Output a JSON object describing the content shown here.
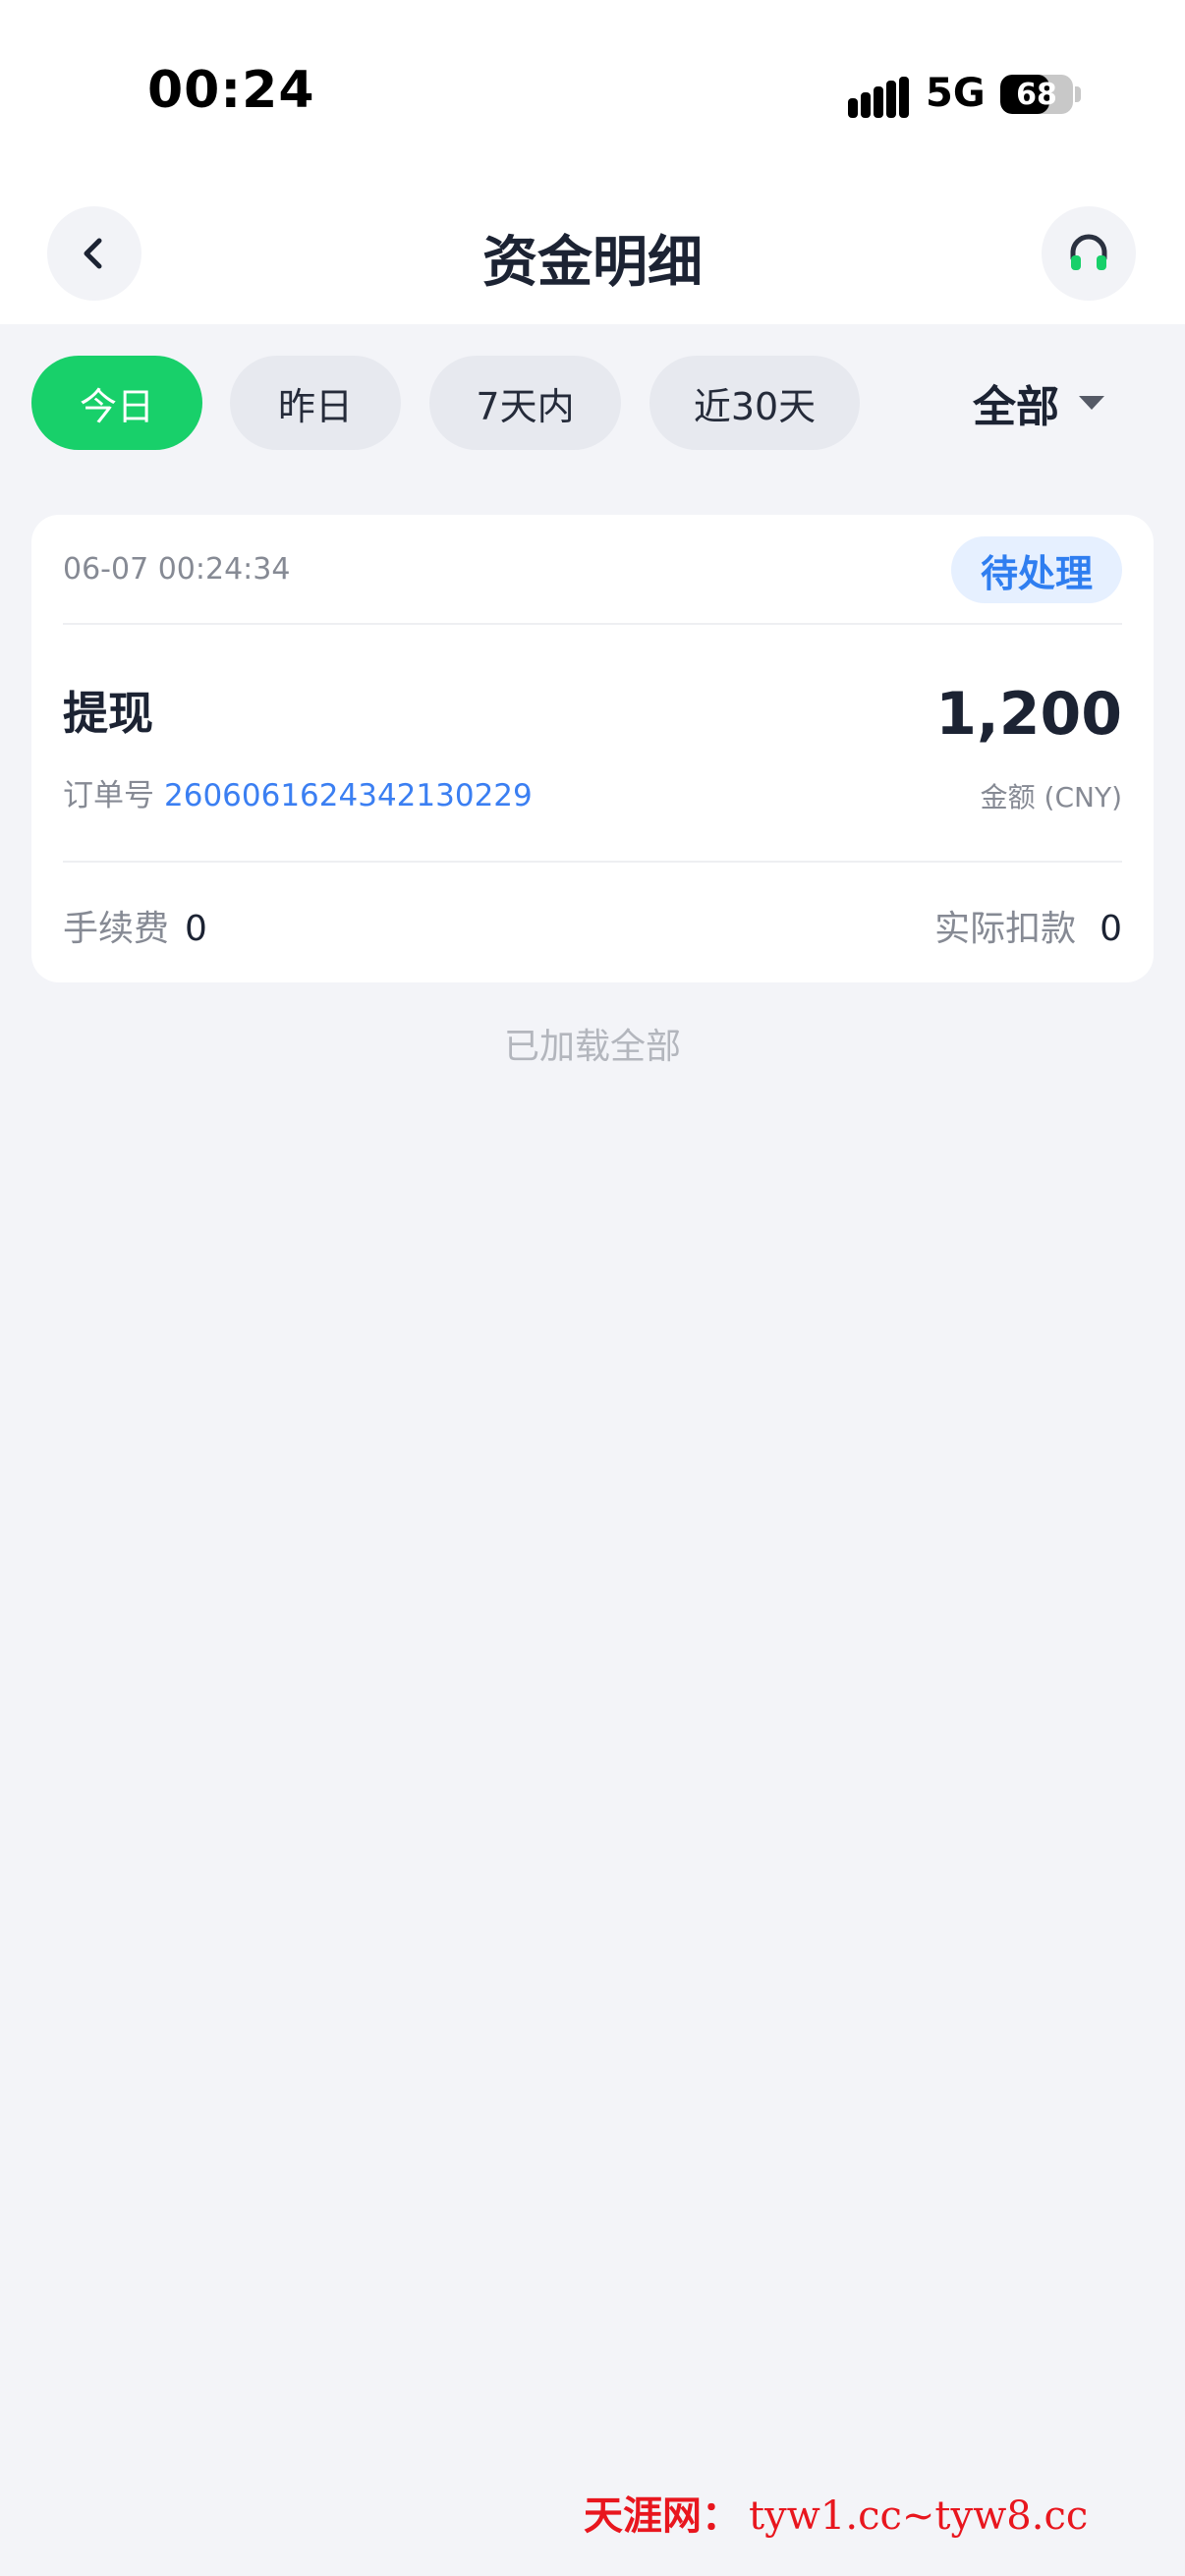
{
  "status_bar": {
    "time": "00:24",
    "network": "5G",
    "battery": "68",
    "battery_level": 0.68
  },
  "header": {
    "title": "资金明细",
    "back_icon": "chevron-left-icon",
    "service_icon": "headset-icon"
  },
  "tabs": [
    {
      "label": "今日",
      "active": true
    },
    {
      "label": "昨日",
      "active": false
    },
    {
      "label": "7天内",
      "active": false
    },
    {
      "label": "近30天",
      "active": false
    }
  ],
  "filter": {
    "label": "全部"
  },
  "record": {
    "datetime": "06-07 00:24:34",
    "status": "待处理",
    "type": "提现",
    "order_label": "订单号",
    "order_no": "2606061624342130229",
    "amount": "1,200",
    "amount_label": "金额 (CNY)",
    "fee_label": "手续费",
    "fee": "0",
    "deduct_label": "实际扣款",
    "deduct": "0"
  },
  "footer": {
    "loaded_text": "已加载全部"
  },
  "watermark": {
    "brand": "天涯网：",
    "urls": "tyw1.cc~tyw8.cc"
  },
  "colors": {
    "accent": "#18d06a",
    "status_blue": "#2f7ef0",
    "background": "#f3f4f8"
  }
}
